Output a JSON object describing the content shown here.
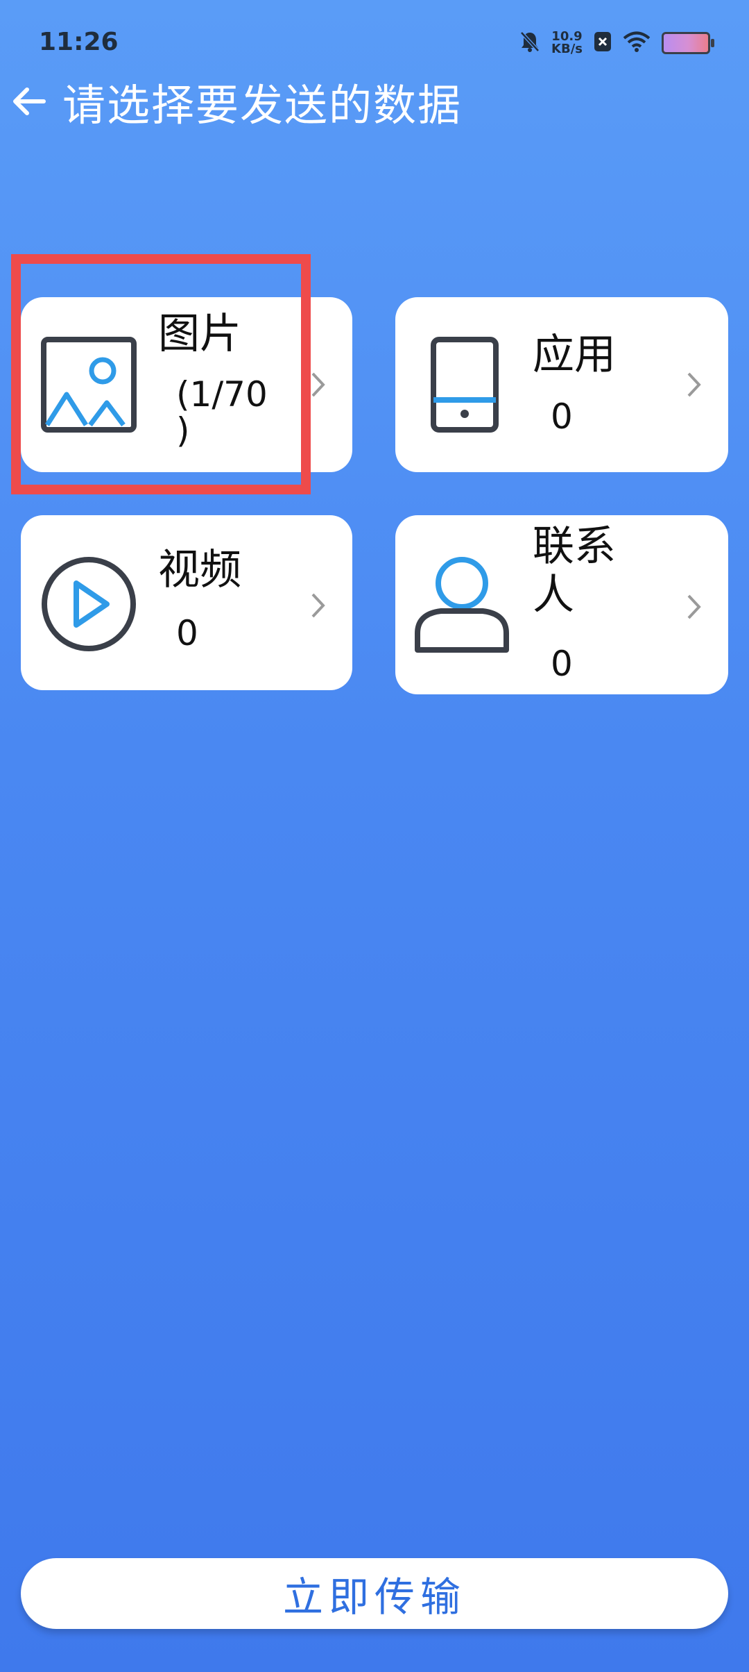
{
  "status_bar": {
    "time": "11:26",
    "net_speed_value": "10.9",
    "net_speed_unit": "KB/s",
    "icons": [
      "bell-muted-icon",
      "x-badge-icon",
      "wifi-icon",
      "battery-icon"
    ]
  },
  "header": {
    "title": "请选择要发送的数据"
  },
  "cards": [
    {
      "name": "图片",
      "count_line1": "(1/70",
      "count_line2": ")",
      "icon": "image-icon",
      "selected": true
    },
    {
      "name": "应用",
      "count": "0",
      "icon": "phone-app-icon"
    },
    {
      "name": "视频",
      "count": "0",
      "icon": "play-icon"
    },
    {
      "name_line1": "联系",
      "name_line2": "人",
      "count": "0",
      "icon": "person-icon"
    }
  ],
  "footer": {
    "transfer_label": "立即传输"
  },
  "colors": {
    "accent": "#2f9be8",
    "icon_stroke": "#3a3f49",
    "highlight": "#ee4b4b",
    "button_text": "#2f6fe0"
  }
}
